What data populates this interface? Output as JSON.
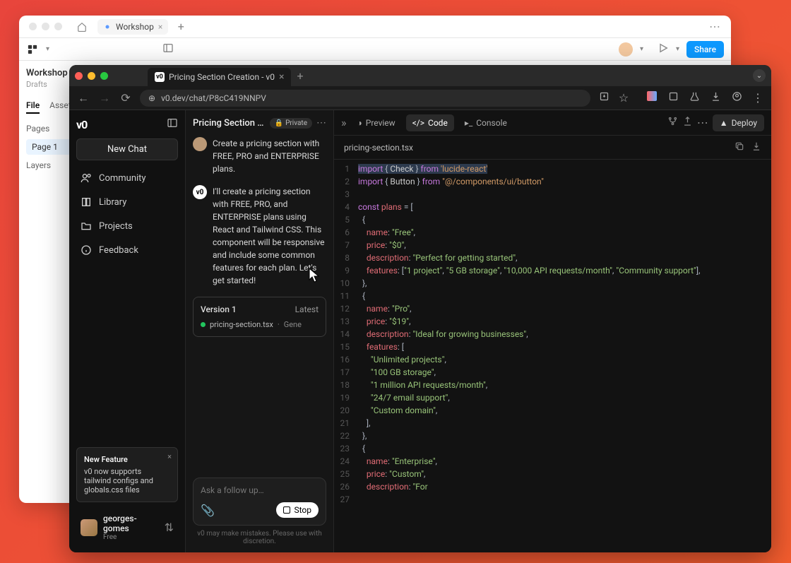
{
  "figma": {
    "tab": "Workshop",
    "workspace": "Workshop",
    "workspace_sub": "Drafts",
    "tabs": {
      "file": "File",
      "assets": "Assets"
    },
    "pages_label": "Pages",
    "page1": "Page 1",
    "layers_label": "Layers",
    "share": "Share"
  },
  "browser": {
    "tab_title": "Pricing Section Creation - v0",
    "url": "v0.dev/chat/P8cC419NNPV"
  },
  "sidebar": {
    "logo": "v0",
    "new_chat": "New Chat",
    "items": [
      {
        "label": "Community"
      },
      {
        "label": "Library"
      },
      {
        "label": "Projects"
      },
      {
        "label": "Feedback"
      }
    ],
    "popup": {
      "title": "New Feature",
      "body": "v0 now supports tailwind configs and globals.css files"
    },
    "user": {
      "name": "georges-gomes",
      "plan": "Free"
    }
  },
  "chat": {
    "title": "Pricing Section Creati…",
    "badge": "Private",
    "user_msg": "Create a pricing section with FREE, PRO and ENTERPRISE plans.",
    "ai_msg": "I'll create a pricing section with FREE, PRO, and ENTERPRISE plans using React and Tailwind CSS. This component will be responsive and include some common features for each plan. Let's get started!",
    "card": {
      "version": "Version 1",
      "latest": "Latest",
      "file": "pricing-section.tsx",
      "status": "Gene"
    },
    "input_placeholder": "Ask a follow up…",
    "stop": "Stop",
    "disclaimer": "v0 may make mistakes. Please use with discretion."
  },
  "code": {
    "tabs": {
      "preview": "Preview",
      "code": "Code",
      "console": "Console"
    },
    "deploy": "Deploy",
    "filename": "pricing-section.tsx",
    "lines": 27,
    "plans": [
      {
        "name": "Free",
        "price": "$0",
        "description": "Perfect for getting started",
        "features": [
          "1 project",
          "5 GB storage",
          "10,000 API requests/month",
          "Community support"
        ]
      },
      {
        "name": "Pro",
        "price": "$19",
        "description": "Ideal for growing businesses",
        "features": [
          "Unlimited projects",
          "100 GB storage",
          "1 million API requests/month",
          "24/7 email support",
          "Custom domain"
        ]
      },
      {
        "name": "Enterprise",
        "price": "Custom",
        "description": "For"
      }
    ]
  }
}
